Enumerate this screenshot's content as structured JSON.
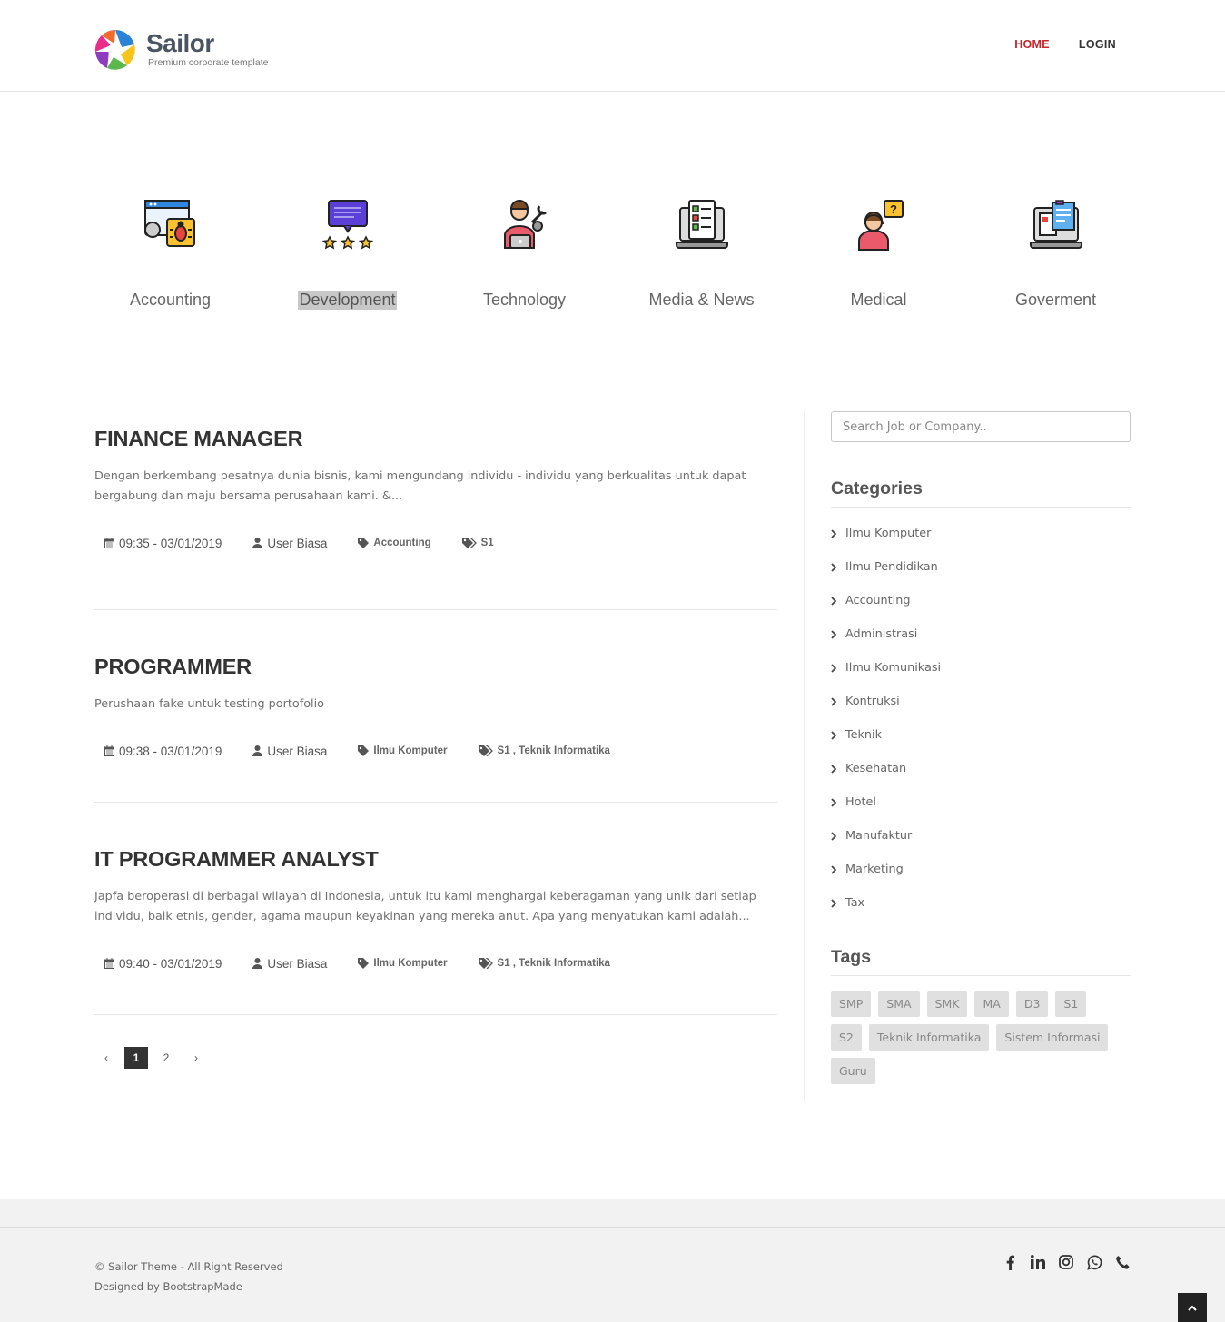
{
  "header": {
    "logo_name": "Sailor",
    "logo_tagline": "Premium corporate template",
    "nav": [
      {
        "label": "HOME",
        "active": true
      },
      {
        "label": "LOGIN",
        "active": false
      }
    ]
  },
  "categories_strip": [
    {
      "label": "Accounting",
      "icon": "bug-browser-icon"
    },
    {
      "label": "Development",
      "icon": "rating-chat-icon",
      "selected": true
    },
    {
      "label": "Technology",
      "icon": "technician-laptop-icon"
    },
    {
      "label": "Media & News",
      "icon": "laptop-checklist-icon"
    },
    {
      "label": "Medical",
      "icon": "support-agent-icon"
    },
    {
      "label": "Goverment",
      "icon": "laptop-documents-icon"
    }
  ],
  "posts": [
    {
      "title": "FINANCE MANAGER",
      "excerpt": "Dengan berkembang pesatnya dunia bisnis, kami mengundang individu - individu yang berkualitas untuk dapat bergabung dan maju bersama perusahaan kami.                    &...",
      "datetime": "09:35 - 03/01/2019",
      "author": "User Biasa",
      "category": "Accounting",
      "education": "S1"
    },
    {
      "title": "PROGRAMMER",
      "excerpt": "Perushaan fake untuk testing portofolio",
      "datetime": "09:38 - 03/01/2019",
      "author": "User Biasa",
      "category": "Ilmu Komputer",
      "education": "S1 , Teknik Informatika"
    },
    {
      "title": "IT PROGRAMMER ANALYST",
      "excerpt": "Japfa beroperasi di berbagai wilayah di Indonesia, untuk itu kami menghargai keberagaman yang unik dari setiap individu, baik etnis, gender, agama maupun keyakinan yang mereka anut.  Apa yang menyatukan kami adalah...",
      "datetime": "09:40 - 03/01/2019",
      "author": "User Biasa",
      "category": "Ilmu Komputer",
      "education": "S1 , Teknik Informatika"
    }
  ],
  "pagination": {
    "prev": "‹",
    "pages": [
      "1",
      "2"
    ],
    "current": "1",
    "next": "›"
  },
  "sidebar": {
    "search_placeholder": "Search Job or Company..",
    "categories_title": "Categories",
    "categories": [
      "Ilmu Komputer",
      "Ilmu Pendidikan",
      "Accounting",
      "Administrasi",
      "Ilmu Komunikasi",
      "Kontruksi",
      "Teknik",
      "Kesehatan",
      "Hotel",
      "Manufaktur",
      "Marketing",
      "Tax"
    ],
    "tags_title": "Tags",
    "tags": [
      "SMP",
      "SMA",
      "SMK",
      "MA",
      "D3",
      "S1",
      "S2",
      "Teknik Informatika",
      "Sistem Informasi",
      "Guru"
    ]
  },
  "footer": {
    "copyright": "© Sailor Theme - All Right Reserved",
    "credit": "Designed by BootstrapMade",
    "social": [
      "facebook-icon",
      "linkedin-icon",
      "instagram-icon",
      "whatsapp-icon",
      "phone-icon"
    ]
  },
  "colors": {
    "accent": "#c9262c",
    "dark": "#333333",
    "tag_bg": "#e0e0e0",
    "footer_bg": "#f2f2f2"
  }
}
